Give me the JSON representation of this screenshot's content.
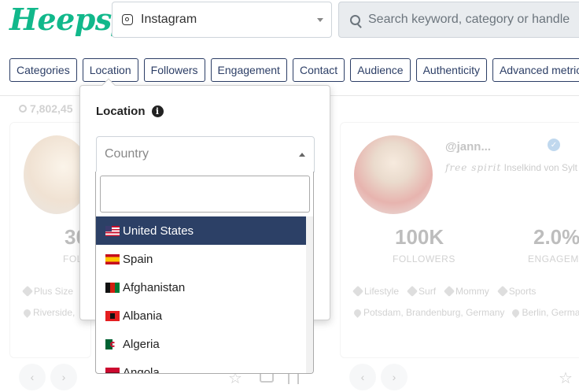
{
  "header": {
    "logo": "Heepsy",
    "platform": "Instagram",
    "search_placeholder": "Search keyword, category or handle"
  },
  "filters": [
    "Categories",
    "Location",
    "Followers",
    "Engagement",
    "Contact",
    "Audience",
    "Authenticity",
    "Advanced metrics"
  ],
  "results": {
    "count": "7,802,45"
  },
  "cards": [
    {
      "followers_partial": "30",
      "followers_label_partial": "FOLLO",
      "tags": [
        "Plus Size"
      ],
      "location_partial": "Riverside,"
    },
    {
      "handle": "@jann...",
      "bio": "Inselkind von Sylt",
      "bio_script": "free spirit",
      "followers": "100K",
      "followers_label": "FOLLOWERS",
      "engagement": "2.0%",
      "engagement_label": "ENGAGEME",
      "tags": [
        "Lifestyle",
        "Surf",
        "Mommy",
        "Sports"
      ],
      "locations": [
        "Potsdam, Brandenburg, Germany",
        "Berlin, Germa"
      ]
    }
  ],
  "location_panel": {
    "title": "Location",
    "country_placeholder": "Country",
    "options": [
      {
        "name": "United States",
        "flag": "us-flag-icon",
        "selected": true
      },
      {
        "name": "Spain",
        "flag": "es-flag-icon",
        "selected": false
      },
      {
        "name": "Afghanistan",
        "flag": "af-flag-icon",
        "selected": false
      },
      {
        "name": "Albania",
        "flag": "al-flag-icon",
        "selected": false
      },
      {
        "name": "Algeria",
        "flag": "dz-flag-icon",
        "selected": false
      },
      {
        "name": "Angola",
        "flag": "ao-flag-icon",
        "selected": false
      }
    ]
  },
  "colors": {
    "brand": "#11b88b",
    "navy": "#2c4066",
    "chip_border": "#2c3e66"
  }
}
